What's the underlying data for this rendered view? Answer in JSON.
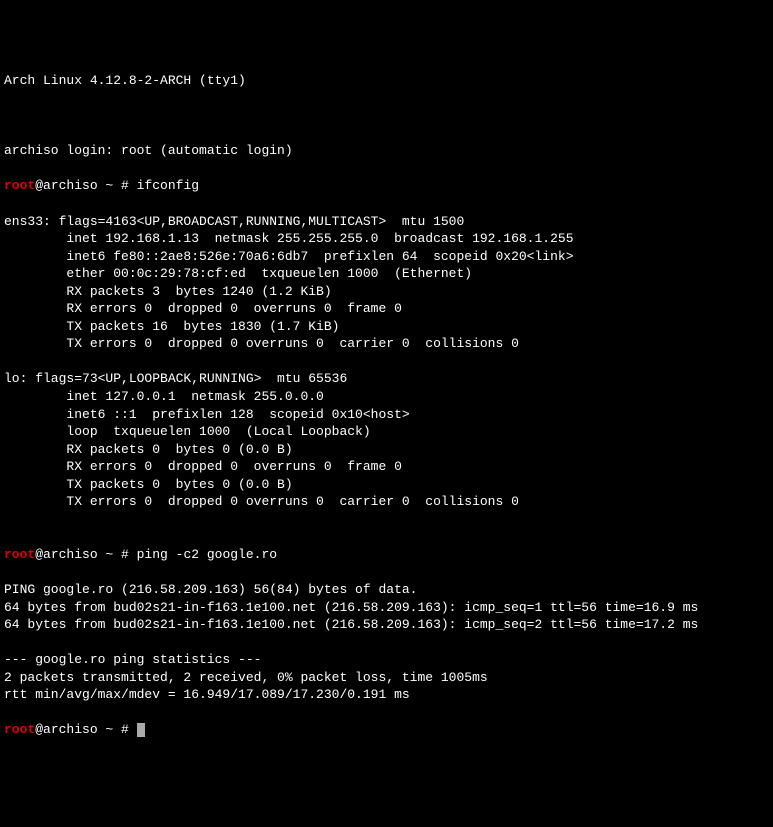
{
  "header": "Arch Linux 4.12.8-2-ARCH (tty1)",
  "blank1": " ",
  "login_line": "archiso login: root (automatic login)",
  "prompt1": {
    "user": "root",
    "rest": "@archiso ~ # ifconfig"
  },
  "ifconfig": [
    "ens33: flags=4163<UP,BROADCAST,RUNNING,MULTICAST>  mtu 1500",
    "        inet 192.168.1.13  netmask 255.255.255.0  broadcast 192.168.1.255",
    "        inet6 fe80::2ae8:526e:70a6:6db7  prefixlen 64  scopeid 0x20<link>",
    "        ether 00:0c:29:78:cf:ed  txqueuelen 1000  (Ethernet)",
    "        RX packets 3  bytes 1240 (1.2 KiB)",
    "        RX errors 0  dropped 0  overruns 0  frame 0",
    "        TX packets 16  bytes 1830 (1.7 KiB)",
    "        TX errors 0  dropped 0 overruns 0  carrier 0  collisions 0",
    " ",
    "lo: flags=73<UP,LOOPBACK,RUNNING>  mtu 65536",
    "        inet 127.0.0.1  netmask 255.0.0.0",
    "        inet6 ::1  prefixlen 128  scopeid 0x10<host>",
    "        loop  txqueuelen 1000  (Local Loopback)",
    "        RX packets 0  bytes 0 (0.0 B)",
    "        RX errors 0  dropped 0  overruns 0  frame 0",
    "        TX packets 0  bytes 0 (0.0 B)",
    "        TX errors 0  dropped 0 overruns 0  carrier 0  collisions 0",
    " "
  ],
  "prompt2": {
    "user": "root",
    "rest": "@archiso ~ # ping -c2 google.ro"
  },
  "ping": [
    "PING google.ro (216.58.209.163) 56(84) bytes of data.",
    "64 bytes from bud02s21-in-f163.1e100.net (216.58.209.163): icmp_seq=1 ttl=56 time=16.9 ms",
    "64 bytes from bud02s21-in-f163.1e100.net (216.58.209.163): icmp_seq=2 ttl=56 time=17.2 ms",
    " ",
    "--- google.ro ping statistics ---",
    "2 packets transmitted, 2 received, 0% packet loss, time 1005ms",
    "rtt min/avg/max/mdev = 16.949/17.089/17.230/0.191 ms"
  ],
  "prompt3": {
    "user": "root",
    "rest": "@archiso ~ # "
  }
}
